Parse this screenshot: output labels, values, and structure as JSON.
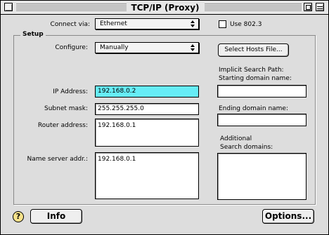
{
  "window": {
    "title": "TCP/IP (Proxy)"
  },
  "top": {
    "connect_via_label": "Connect via:",
    "connect_via_value": "Ethernet",
    "use_8023_label": "Use 802.3",
    "use_8023_checked": false
  },
  "setup": {
    "group_title": "Setup",
    "configure_label": "Configure:",
    "configure_value": "Manually",
    "select_hosts_label": "Select Hosts File...",
    "ip_label": "IP Address:",
    "ip_value": "192.168.0.2",
    "subnet_label": "Subnet mask:",
    "subnet_value": "255.255.255.0",
    "router_label": "Router address:",
    "router_value": "192.168.0.1",
    "nameserver_label": "Name server addr.:",
    "nameserver_value": "192.168.0.1",
    "implicit_search_label": "Implicit Search Path:",
    "starting_domain_label": "Starting domain name:",
    "starting_domain_value": "",
    "ending_domain_label": "Ending domain name:",
    "ending_domain_value": "",
    "additional_label": "Additional",
    "search_domains_label": "Search domains:",
    "search_domains_value": ""
  },
  "bottom": {
    "help_icon": "?",
    "info_label": "Info",
    "options_label": "Options..."
  },
  "colors": {
    "selection": "#66ecf6",
    "window_bg": "#dddddd",
    "help_icon_bg": "#f7e28a"
  }
}
